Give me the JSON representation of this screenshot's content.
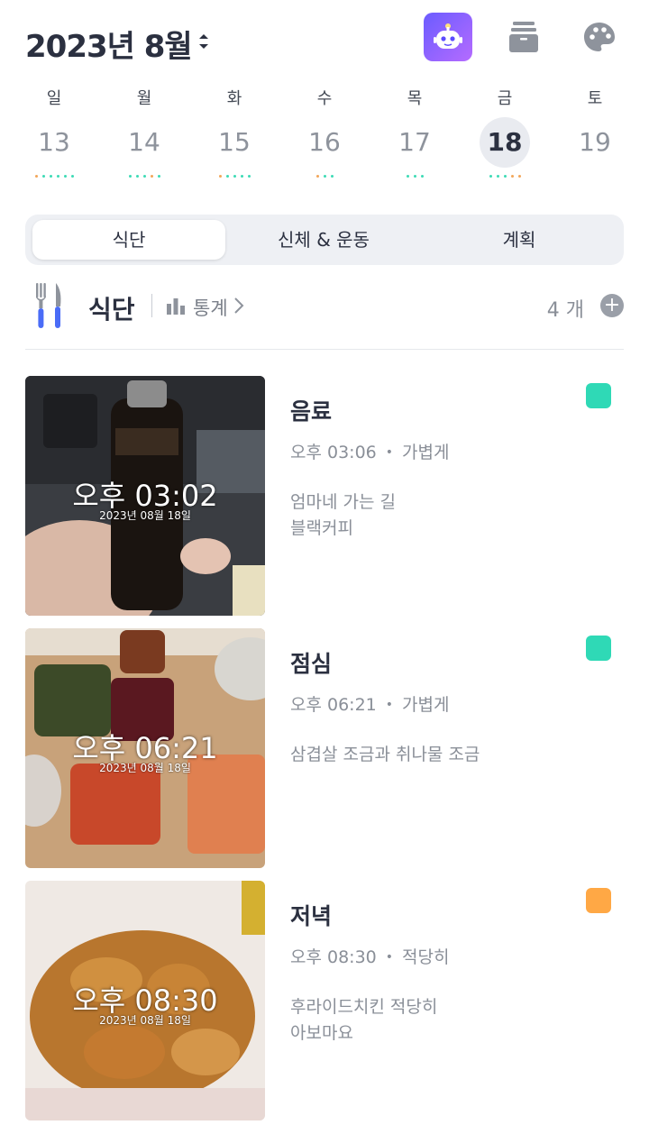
{
  "header": {
    "month_title": "2023년 8월",
    "icons": [
      "sort-arrows-icon",
      "robot-assistant-icon",
      "archive-box-icon",
      "palette-icon"
    ]
  },
  "week": [
    {
      "weekday": "일",
      "date": "13",
      "selected": false,
      "dot_colors": [
        "#f2a65a",
        "#3ddbb6",
        "#3ddbb6",
        "#3ddbb6",
        "#3ddbb6",
        "#3ddbb6"
      ]
    },
    {
      "weekday": "월",
      "date": "14",
      "selected": false,
      "dot_colors": [
        "#3ddbb6",
        "#3ddbb6",
        "#3ddbb6",
        "#f2a65a",
        "#3ddbb6"
      ]
    },
    {
      "weekday": "화",
      "date": "15",
      "selected": false,
      "dot_colors": [
        "#f2a65a",
        "#3ddbb6",
        "#3ddbb6",
        "#3ddbb6",
        "#3ddbb6"
      ]
    },
    {
      "weekday": "수",
      "date": "16",
      "selected": false,
      "dot_colors": [
        "#f2a65a",
        "#3ddbb6",
        "#3ddbb6"
      ]
    },
    {
      "weekday": "목",
      "date": "17",
      "selected": false,
      "dot_colors": [
        "#3ddbb6",
        "#3ddbb6",
        "#3ddbb6"
      ]
    },
    {
      "weekday": "금",
      "date": "18",
      "selected": true,
      "dot_colors": [
        "#3ddbb6",
        "#3ddbb6",
        "#3ddbb6",
        "#f2a65a",
        "#f2a65a"
      ]
    },
    {
      "weekday": "토",
      "date": "19",
      "selected": false,
      "dot_colors": []
    }
  ],
  "tabs": [
    {
      "label": "식단",
      "active": true
    },
    {
      "label": "신체 & 운동",
      "active": false
    },
    {
      "label": "계획",
      "active": false
    }
  ],
  "section": {
    "title": "식단",
    "stats_label": "통계",
    "count": "4 개"
  },
  "meals": [
    {
      "name": "음료",
      "time": "오후 03:06",
      "amount": "가볍게",
      "memo": [
        "엄마네 가는 길",
        "블랙커피"
      ],
      "tag_color": "#2fd9b6",
      "photo_time": "오후 03:02",
      "photo_date": "2023년 08월 18일",
      "photo_desc": "bottled black coffee held in a car"
    },
    {
      "name": "점심",
      "time": "오후 06:21",
      "amount": "가볍게",
      "memo": [
        "삼겹살 조금과 취나물 조금"
      ],
      "tag_color": "#2fd9b6",
      "photo_time": "오후 06:21",
      "photo_date": "2023년 08월 18일",
      "photo_desc": "side dishes on a wooden table"
    },
    {
      "name": "저녁",
      "time": "오후 08:30",
      "amount": "적당히",
      "memo": [
        "후라이드치킨 적당히",
        "아보마요"
      ],
      "tag_color": "#ffa845",
      "photo_time": "오후 08:30",
      "photo_date": "2023년 08월 18일",
      "photo_desc": "fried chicken in a box"
    }
  ]
}
